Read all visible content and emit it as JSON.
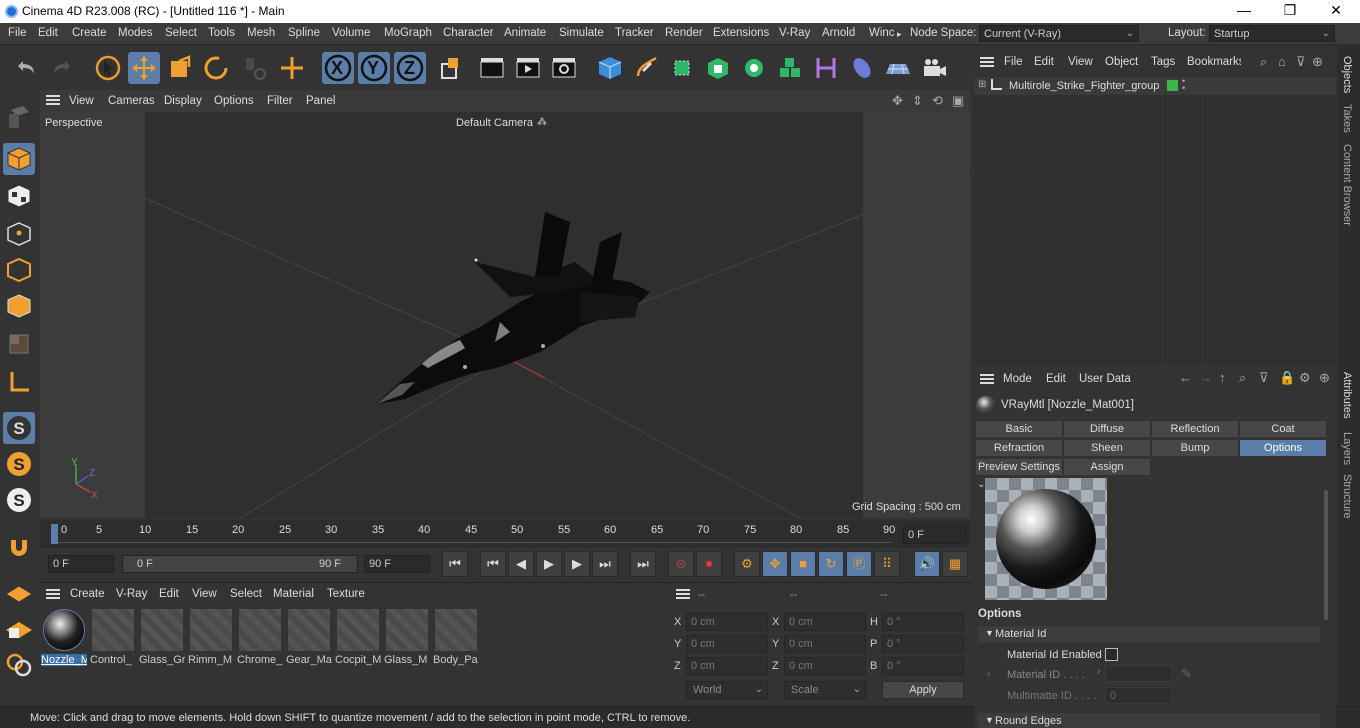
{
  "window": {
    "title": "Cinema 4D R23.008 (RC) - [Untitled 116 *] - Main",
    "minimize": "—",
    "maximize": "❐",
    "close": "✕"
  },
  "menu": {
    "items": [
      "File",
      "Edit",
      "Create",
      "Modes",
      "Select",
      "Tools",
      "Mesh",
      "Spline",
      "Volume",
      "MoGraph",
      "Character",
      "Animate",
      "Simulate",
      "Tracker",
      "Render",
      "Extensions",
      "V-Ray",
      "Arnold",
      "Winc"
    ],
    "more": "▸",
    "node_space_label": "Node Space:",
    "node_space_value": "Current (V-Ray)",
    "layout_label": "Layout:",
    "layout_value": "Startup"
  },
  "toolbar": {
    "axis_x": "X",
    "axis_y": "Y",
    "axis_z": "Z"
  },
  "viewport": {
    "menu": [
      "View",
      "Cameras",
      "Display",
      "Options",
      "Filter",
      "Panel"
    ],
    "projection": "Perspective",
    "camera": "Default Camera",
    "grid_spacing": "Grid Spacing : 500 cm",
    "axis_x": "X",
    "axis_y": "Y",
    "axis_z": "Z"
  },
  "timeline": {
    "ticks": [
      "0",
      "5",
      "10",
      "15",
      "20",
      "25",
      "30",
      "35",
      "40",
      "45",
      "50",
      "55",
      "60",
      "65",
      "70",
      "75",
      "80",
      "85",
      "90"
    ],
    "current_frame": "0 F",
    "start_frame": "0 F",
    "range_start": "0 F",
    "range_end": "90 F",
    "end_frame": "90 F"
  },
  "material_manager": {
    "menu": [
      "Create",
      "V-Ray",
      "Edit",
      "View",
      "Select",
      "Material",
      "Texture"
    ],
    "materials": [
      "Nozzle_M",
      "Control_",
      "Glass_Gr",
      "Rimm_M",
      "Chrome_",
      "Gear_Ma",
      "Cocpit_M",
      "Glass_M",
      "Body_Pa"
    ]
  },
  "coordinates": {
    "header": [
      "--",
      "--",
      "--"
    ],
    "rows": [
      {
        "l1": "X",
        "v1": "0 cm",
        "l2": "X",
        "v2": "0 cm",
        "l3": "H",
        "v3": "0 °"
      },
      {
        "l1": "Y",
        "v1": "0 cm",
        "l2": "Y",
        "v2": "0 cm",
        "l3": "P",
        "v3": "0 °"
      },
      {
        "l1": "Z",
        "v1": "0 cm",
        "l2": "Z",
        "v2": "0 cm",
        "l3": "B",
        "v3": "0 °"
      }
    ],
    "space": "World",
    "mode": "Scale",
    "apply": "Apply"
  },
  "object_manager": {
    "menu": [
      "File",
      "Edit",
      "View",
      "Object",
      "Tags",
      "Bookmarks"
    ],
    "objects": [
      {
        "name": "Multirole_Strike_Fighter_group"
      }
    ]
  },
  "attribute_manager": {
    "menu": [
      "Mode",
      "Edit",
      "User Data"
    ],
    "material_title": "VRayMtl [Nozzle_Mat001]",
    "tabs_row1": [
      "Basic",
      "Diffuse",
      "Reflection",
      "Coat"
    ],
    "tabs_row2": [
      "Refraction",
      "Sheen",
      "Bump",
      "Options"
    ],
    "tabs_row3": [
      "Preview Settings",
      "Assign"
    ],
    "section_title": "Options",
    "group_material_id": "Material Id",
    "material_id_enabled": "Material Id Enabled",
    "material_id": "Material ID . . . .",
    "multimatte_id": "Multimatte ID . . . .",
    "multimatte_value": "0",
    "group_round_edges": "Round Edges"
  },
  "side_tabs": {
    "top": [
      "Objects",
      "Takes",
      "Content Browser"
    ],
    "bottom": [
      "Attributes",
      "Layers",
      "Structure"
    ]
  },
  "status": {
    "text": "Move: Click and drag to move elements. Hold down SHIFT to quantize movement / add to the selection in point mode, CTRL to remove."
  }
}
